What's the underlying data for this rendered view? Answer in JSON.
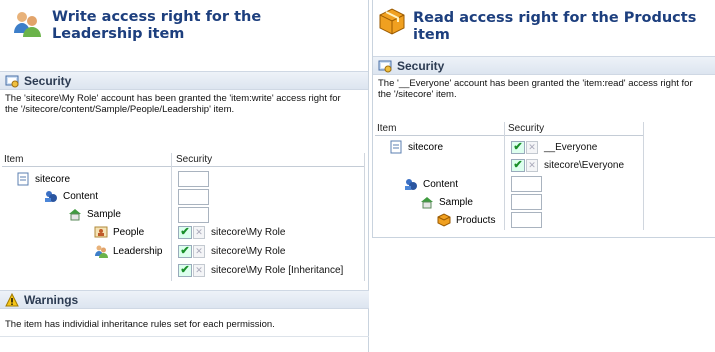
{
  "left": {
    "title": "Write access right for the Leadership item",
    "security_label": "Security",
    "description": "The 'sitecore\\My Role' account has been granted the 'item:write' access right for the '/sitecore/content/Sample/People/Leadership' item.",
    "col_item": "Item",
    "col_security": "Security",
    "tree": [
      "sitecore",
      "Content",
      "Sample",
      "People",
      "Leadership"
    ],
    "accounts": [
      "sitecore\\My Role",
      "sitecore\\My Role",
      "sitecore\\My Role [Inheritance]"
    ],
    "warnings_label": "Warnings",
    "warning_text": "The item has individial inheritance rules set for each permission."
  },
  "right": {
    "title": "Read access right for the Products item",
    "security_label": "Security",
    "description": "The '__Everyone' account has been granted the 'item:read' access right for the '/sitecore' item.",
    "col_item": "Item",
    "col_security": "Security",
    "tree": [
      "sitecore",
      "Content",
      "Sample",
      "Products"
    ],
    "accounts": [
      "__Everyone",
      "sitecore\\Everyone"
    ]
  },
  "icons": {
    "allow": "check-icon",
    "deny": "deny-x-icon"
  },
  "colors": {
    "title": "#1d3f7e",
    "allow_check": "#1a8f2a"
  }
}
